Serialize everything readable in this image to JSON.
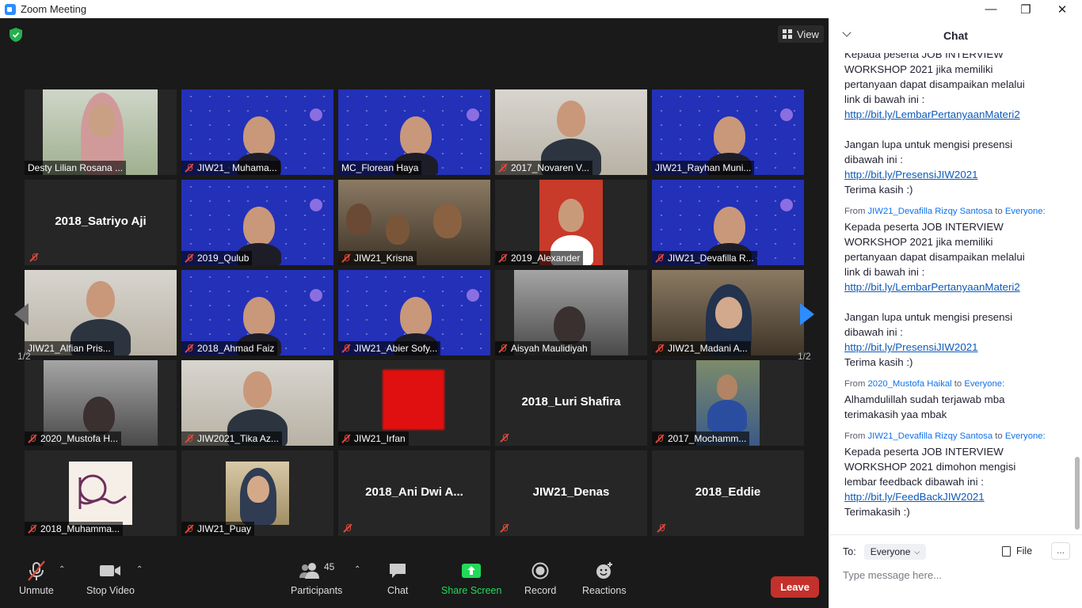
{
  "window": {
    "title": "Zoom Meeting",
    "controls": [
      "minimize",
      "restore",
      "close"
    ]
  },
  "view_button": {
    "label": "View"
  },
  "gallery": {
    "page_left": "1/2",
    "page_right": "1/2",
    "tiles": [
      {
        "name": "Desty Lilian Rosana ...",
        "muted": false,
        "video": true
      },
      {
        "name": "JIW21_ Muhama...",
        "muted": true,
        "video": true
      },
      {
        "name": "MC_Florean Haya",
        "muted": false,
        "video": true
      },
      {
        "name": "2017_Novaren V...",
        "muted": true,
        "video": true
      },
      {
        "name": "JIW21_Rayhan Muni...",
        "muted": false,
        "video": true,
        "active_speaker": true
      },
      {
        "name": "2018_Satriyo Aji",
        "muted": true,
        "video": false
      },
      {
        "name": "2019_Qulub",
        "muted": true,
        "video": true
      },
      {
        "name": "JIW21_Krisna",
        "muted": true,
        "video": true
      },
      {
        "name": "2019_Alexander",
        "muted": true,
        "video": true
      },
      {
        "name": "JIW21_Devafilla R...",
        "muted": true,
        "video": true
      },
      {
        "name": "JIW21_Alfian Pris...",
        "muted": false,
        "video": true
      },
      {
        "name": "2018_Ahmad Faiz",
        "muted": true,
        "video": true
      },
      {
        "name": "JIW21_Abier Sofy...",
        "muted": true,
        "video": true
      },
      {
        "name": "Aisyah Maulidiyah",
        "muted": true,
        "video": true
      },
      {
        "name": "JIW21_Madani A...",
        "muted": true,
        "video": true
      },
      {
        "name": "2020_Mustofa H...",
        "muted": true,
        "video": true
      },
      {
        "name": "JIW2021_Tika Az...",
        "muted": true,
        "video": true
      },
      {
        "name": "JIW21_Irfan",
        "muted": true,
        "video": true
      },
      {
        "name": "2018_Luri Shafira",
        "muted": true,
        "video": false
      },
      {
        "name": "2017_Mochamm...",
        "muted": true,
        "video": true
      },
      {
        "name": "2018_Muhamma...",
        "muted": true,
        "video": true
      },
      {
        "name": "JIW21_Puay",
        "muted": true,
        "video": true
      },
      {
        "name": "2018_Ani Dwi A...",
        "muted": true,
        "video": false
      },
      {
        "name": "JIW21_Denas",
        "muted": true,
        "video": false
      },
      {
        "name": "2018_Eddie",
        "muted": true,
        "video": false
      }
    ]
  },
  "toolbar": {
    "unmute": "Unmute",
    "stop_video": "Stop Video",
    "participants": "Participants",
    "participants_count": "45",
    "chat": "Chat",
    "share_screen": "Share Screen",
    "record": "Record",
    "reactions": "Reactions",
    "leave": "Leave",
    "share_color": "#23d959",
    "leave_color": "#c4312c"
  },
  "chat": {
    "title": "Chat",
    "messages": [
      {
        "from": "",
        "to": "",
        "lines": [
          "Kepada peserta JOB INTERVIEW",
          "WORKSHOP 2021 jika memiliki",
          "pertanyaan dapat disampaikan melalui",
          "link di bawah ini :"
        ],
        "link1": "http://bit.ly/LembarPertanyaanMateri2",
        "lines2": [
          "Jangan lupa untuk mengisi presensi",
          "dibawah ini :"
        ],
        "link2": "http://bit.ly/PresensiJIW2021",
        "closing": "Terima kasih :)"
      },
      {
        "from": "JIW21_Devafilla Rizqy Santosa",
        "to": "Everyone:",
        "lines": [
          "Kepada peserta JOB INTERVIEW",
          "WORKSHOP 2021 jika memiliki",
          "pertanyaan dapat disampaikan melalui",
          "link di bawah ini :"
        ],
        "link1": "http://bit.ly/LembarPertanyaanMateri2",
        "lines2": [
          "Jangan lupa untuk mengisi presensi",
          "dibawah ini :"
        ],
        "link2": "http://bit.ly/PresensiJIW2021",
        "closing": "Terima kasih :)"
      },
      {
        "from": "2020_Mustofa Haikal",
        "to": "Everyone:",
        "lines": [
          "Alhamdulillah sudah terjawab mba",
          "terimakasih yaa mbak"
        ]
      },
      {
        "from": "JIW21_Devafilla Rizqy Santosa",
        "to": "Everyone:",
        "lines": [
          "Kepada peserta JOB INTERVIEW",
          "WORKSHOP 2021 dimohon mengisi",
          "lembar feedback dibawah ini :"
        ],
        "link1": "http://bit.ly/FeedBackJIW2021",
        "closing": "Terimakasih :)"
      }
    ],
    "from_prefix": "From",
    "to_word": "to",
    "to_label": "To:",
    "recipient": "Everyone",
    "file_label": "File",
    "more_label": "...",
    "input_placeholder": "Type message here..."
  }
}
